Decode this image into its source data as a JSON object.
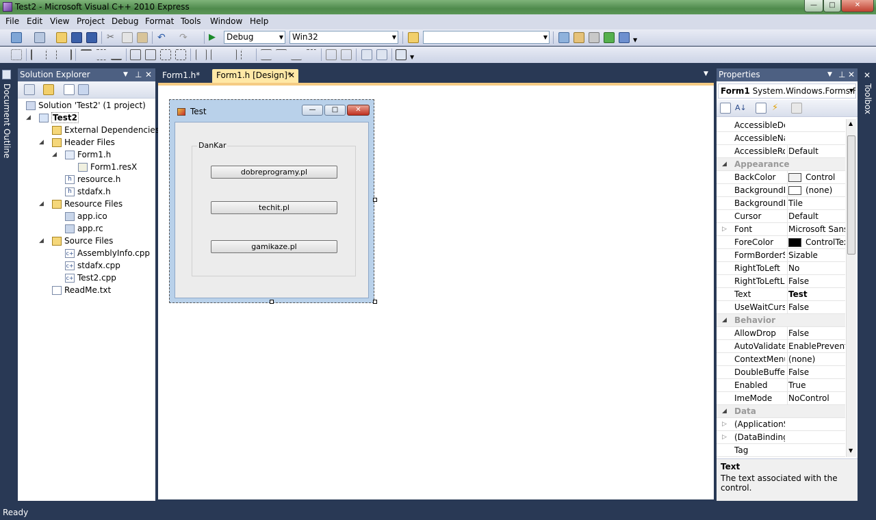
{
  "window": {
    "title": "Test2 - Microsoft Visual C++ 2010 Express",
    "min": "—",
    "max": "□",
    "close": "✕"
  },
  "menu": [
    "File",
    "Edit",
    "View",
    "Project",
    "Debug",
    "Format",
    "Tools",
    "Window",
    "Help"
  ],
  "toolbar": {
    "config": "Debug",
    "platform": "Win32",
    "find": ""
  },
  "left_tab": "Document Outline",
  "right_tab": "Toolbox",
  "solution_explorer": {
    "title": "Solution Explorer",
    "items": [
      {
        "label": "Solution 'Test2' (1 project)"
      },
      {
        "label": "Test2"
      },
      {
        "label": "External Dependencies"
      },
      {
        "label": "Header Files"
      },
      {
        "label": "Form1.h"
      },
      {
        "label": "Form1.resX"
      },
      {
        "label": "resource.h"
      },
      {
        "label": "stdafx.h"
      },
      {
        "label": "Resource Files"
      },
      {
        "label": "app.ico"
      },
      {
        "label": "app.rc"
      },
      {
        "label": "Source Files"
      },
      {
        "label": "AssemblyInfo.cpp"
      },
      {
        "label": "stdafx.cpp"
      },
      {
        "label": "Test2.cpp"
      },
      {
        "label": "ReadMe.txt"
      }
    ]
  },
  "tabs": [
    {
      "label": "Form1.h*"
    },
    {
      "label": "Form1.h [Design]*"
    }
  ],
  "designer": {
    "form_title": "Test",
    "groupbox": "DanKar",
    "buttons": [
      "dobreprogramy.pl",
      "techit.pl",
      "gamikaze.pl"
    ]
  },
  "properties": {
    "title": "Properties",
    "object": "Form1",
    "object_type": "System.Windows.Forms.Fo",
    "rows": [
      {
        "name": "AccessibleDes",
        "value": ""
      },
      {
        "name": "AccessibleNar",
        "value": ""
      },
      {
        "name": "AccessibleRol",
        "value": "Default"
      },
      {
        "name": "Appearance",
        "value": ""
      },
      {
        "name": "BackColor",
        "value": "Control"
      },
      {
        "name": "BackgroundIr",
        "value": "(none)"
      },
      {
        "name": "BackgroundIr",
        "value": "Tile"
      },
      {
        "name": "Cursor",
        "value": "Default"
      },
      {
        "name": "Font",
        "value": "Microsoft Sans S"
      },
      {
        "name": "ForeColor",
        "value": "ControlTex"
      },
      {
        "name": "FormBorderSt",
        "value": "Sizable"
      },
      {
        "name": "RightToLeft",
        "value": "No"
      },
      {
        "name": "RightToLeftLa",
        "value": "False"
      },
      {
        "name": "Text",
        "value": "Test"
      },
      {
        "name": "UseWaitCursc",
        "value": "False"
      },
      {
        "name": "Behavior",
        "value": ""
      },
      {
        "name": "AllowDrop",
        "value": "False"
      },
      {
        "name": "AutoValidate",
        "value": "EnablePreventFc"
      },
      {
        "name": "ContextMenu",
        "value": "(none)"
      },
      {
        "name": "DoubleBuffer",
        "value": "False"
      },
      {
        "name": "Enabled",
        "value": "True"
      },
      {
        "name": "ImeMode",
        "value": "NoControl"
      },
      {
        "name": "Data",
        "value": ""
      },
      {
        "name": "(ApplicationS",
        "value": ""
      },
      {
        "name": "(DataBindings",
        "value": ""
      },
      {
        "name": "Tag",
        "value": ""
      }
    ],
    "desc_title": "Text",
    "desc_text": "The text associated with the control."
  },
  "status": "Ready",
  "colors": {
    "chrome": "#293955",
    "accent": "#f5cc84",
    "selected_tab": "#ffe8a6"
  }
}
